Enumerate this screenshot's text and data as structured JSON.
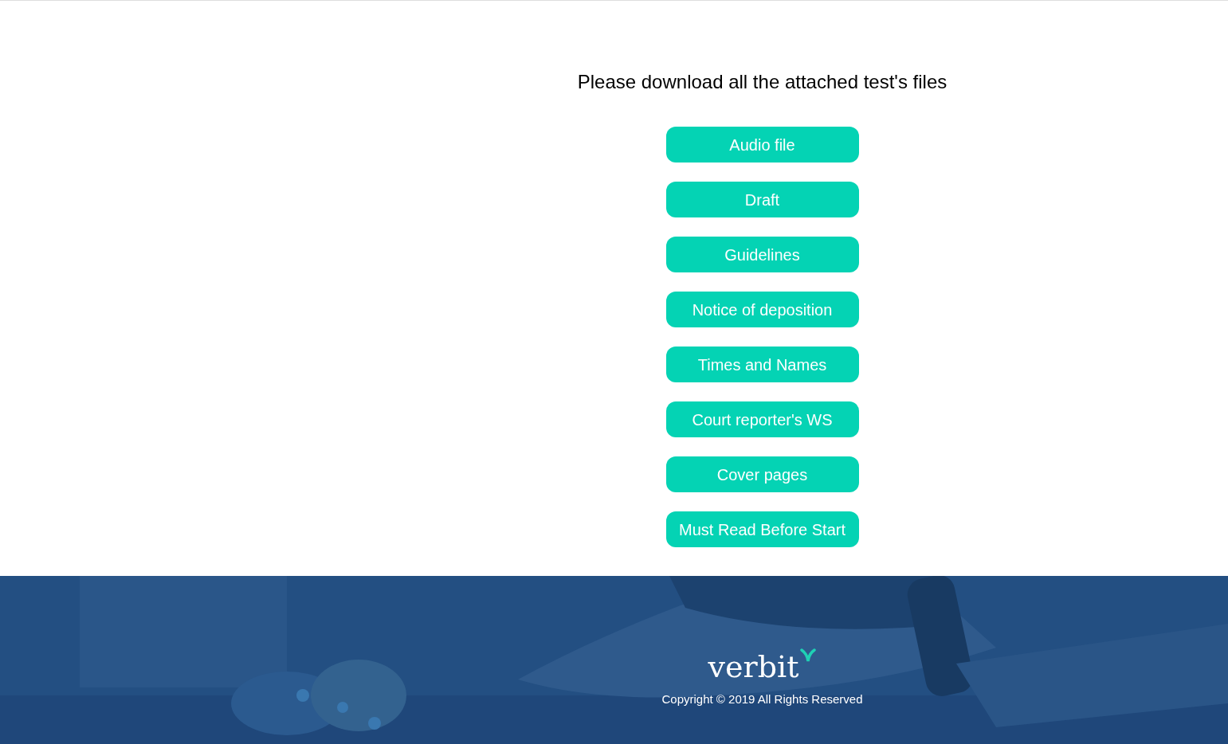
{
  "heading": "Please download all the attached test's files",
  "buttons": [
    "Audio file",
    "Draft",
    "Guidelines",
    "Notice of deposition",
    "Times and Names",
    "Court reporter's WS",
    "Cover pages",
    "Must Read Before Start"
  ],
  "footer": {
    "logo": "verbit",
    "copyright": "Copyright © 2019 All Rights Reserved"
  }
}
